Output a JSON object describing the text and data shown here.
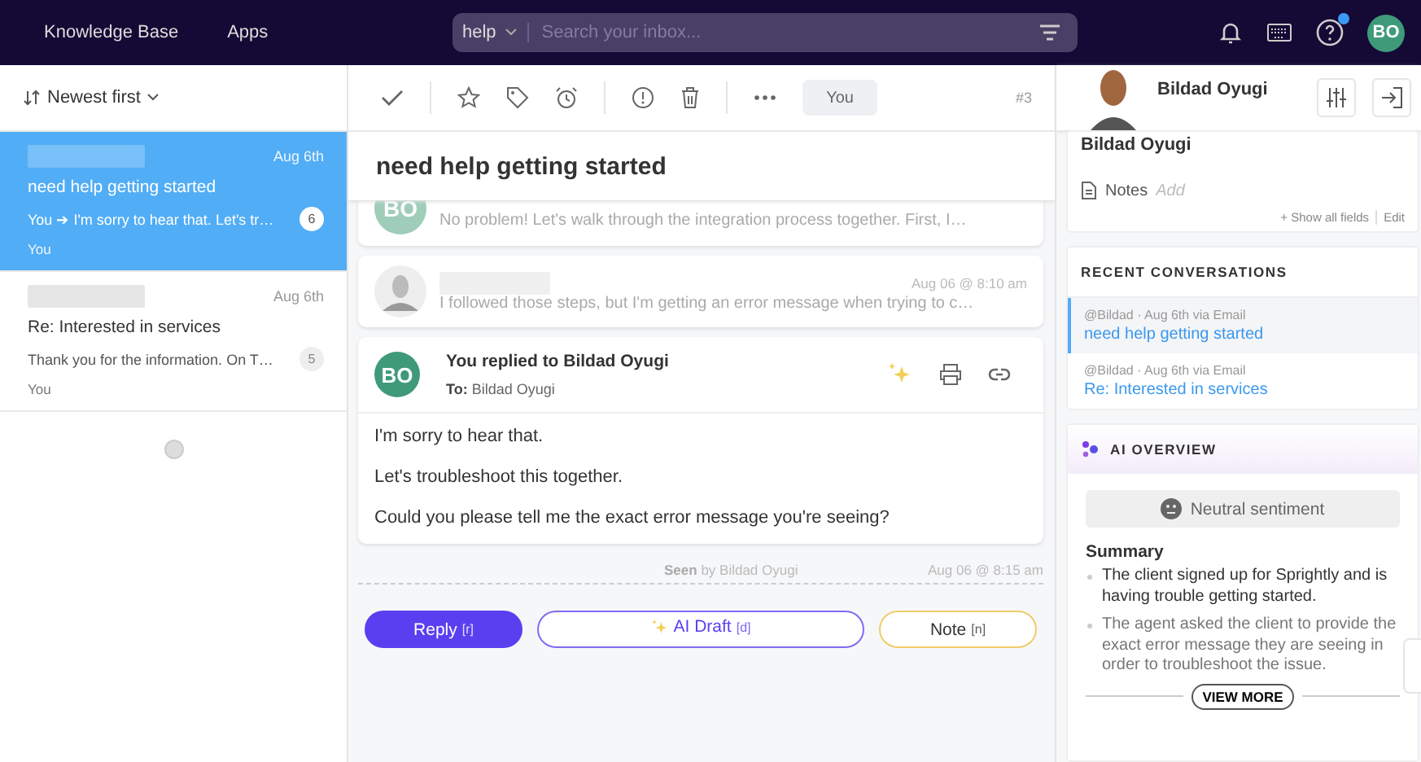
{
  "topbar": {
    "nav": [
      "Knowledge Base",
      "Apps"
    ],
    "search": {
      "scope": "help",
      "placeholder": "Search your inbox..."
    },
    "help_unread": true,
    "avatar": "BO"
  },
  "list": {
    "sort": "Newest first",
    "conversations": [
      {
        "date": "Aug 6th",
        "subject": "need help getting started",
        "preview": "You ➔ I'm sorry to hear that. Let's tr…",
        "count": "6",
        "assignee": "You",
        "selected": true
      },
      {
        "date": "Aug 6th",
        "subject": "Re: Interested in services",
        "preview": "Thank you for the information.  On T…",
        "count": "5",
        "assignee": "You",
        "selected": false
      }
    ]
  },
  "thread": {
    "assignee": "You",
    "number": "#3",
    "title": "need help getting started",
    "messages": [
      {
        "kind": "collapsed",
        "avatar": "BO",
        "preview": "No problem!   Let's walk through the integration process together. First, I…"
      },
      {
        "kind": "collapsed",
        "time": "Aug 06 @ 8:10 am",
        "preview": "I followed those steps, but I'm getting an error message when trying to c…"
      },
      {
        "kind": "expanded",
        "avatar": "BO",
        "title": "You replied to Bildad Oyugi",
        "to_label": "To:",
        "to": "Bildad Oyugi",
        "paragraphs": [
          "I'm sorry to hear that.",
          "Let's troubleshoot this together.",
          "Could you please tell me the exact error message you're seeing?"
        ]
      }
    ],
    "seen": "**Seen** by Bildad Oyugi",
    "seen_time": "Aug 06 @ 8:15 am",
    "actions": [
      {
        "kind": "primary",
        "label": "Reply",
        "key": "[r]"
      },
      {
        "kind": "ai",
        "label": "AI Draft",
        "key": "[d]"
      },
      {
        "kind": "note",
        "label": "Note",
        "key": "[n]"
      }
    ]
  },
  "contact": {
    "name": "Bildad Oyugi",
    "card_name": "Bildad Oyugi",
    "notes_label": "Notes",
    "notes_placeholder": "Add",
    "show_all": "+ Show all fields",
    "edit": "Edit"
  },
  "recent": {
    "title": "RECENT CONVERSATIONS",
    "items": [
      {
        "meta": "@Bildad · Aug 6th via Email",
        "subject": "need help getting started",
        "selected": true
      },
      {
        "meta": "@Bildad · Aug 6th via Email",
        "subject": "Re: Interested in services",
        "selected": false
      }
    ]
  },
  "ai": {
    "title": "AI OVERVIEW",
    "sentiment": "Neutral sentiment",
    "summary_title": "Summary",
    "bullets": [
      "The client signed up for Sprightly and is having trouble getting started.",
      "The agent asked the client to provide the exact error message they are seeing in order to troubleshoot the issue."
    ],
    "more": "VIEW MORE"
  }
}
